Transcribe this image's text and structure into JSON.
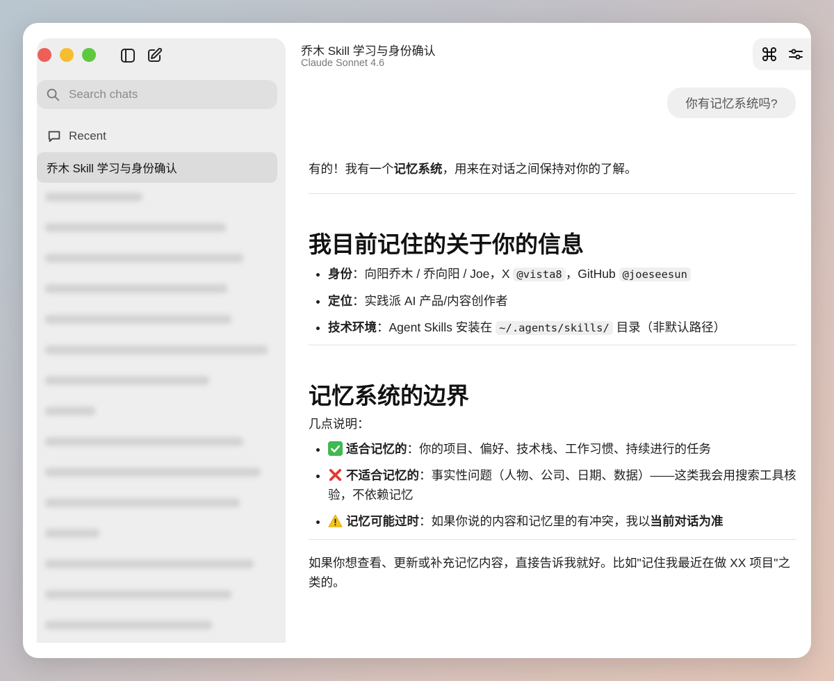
{
  "sidebar": {
    "search_placeholder": "Search chats",
    "recent_label": "Recent",
    "active_chat": "乔木 Skill 学习与身份确认"
  },
  "header": {
    "title": "乔木 Skill 学习与身份确认",
    "model": "Claude Sonnet 4.6"
  },
  "user_message": "你有记忆系统吗?",
  "assistant": {
    "intro_pre": "有的！我有一个",
    "intro_bold": "记忆系统",
    "intro_post": "，用来在对话之间保持对你的了解。",
    "section1_title": "我目前记住的关于你的信息",
    "s1_item1_label": "身份",
    "s1_item1_text1": "：向阳乔木 / 乔向阳 / Joe，X ",
    "s1_item1_code1": "@vista8",
    "s1_item1_text2": "，GitHub ",
    "s1_item1_code2": "@joeseesun",
    "s1_item2_label": "定位",
    "s1_item2_text": "：实践派 AI 产品/内容创作者",
    "s1_item3_label": "技术环境",
    "s1_item3_text1": "：Agent Skills 安装在 ",
    "s1_item3_code": "~/.agents/skills/",
    "s1_item3_text2": " 目录（非默认路径）",
    "section2_title": "记忆系统的边界",
    "section2_intro": "几点说明：",
    "s2_item1_label": "适合记忆的",
    "s2_item1_text": "：你的项目、偏好、技术栈、工作习惯、持续进行的任务",
    "s2_item2_label": "不适合记忆的",
    "s2_item2_text": "：事实性问题（人物、公司、日期、数据）——这类我会用搜索工具核验，不依赖记忆",
    "s2_item3_label": "记忆可能过时",
    "s2_item3_text1": "：如果你说的内容和记忆里的有冲突，我以",
    "s2_item3_bold": "当前对话为准",
    "closing": "如果你想查看、更新或补充记忆内容，直接告诉我就好。比如\"记住我最近在做 XX 项目\"之类的。"
  },
  "icons": [
    "sidebar-toggle-icon",
    "new-chat-icon",
    "search-icon",
    "chat-bubble-icon",
    "command-icon",
    "sliders-icon",
    "check-emoji-icon",
    "cross-emoji-icon",
    "warning-emoji-icon"
  ],
  "colors": {
    "close": "#ee5f57",
    "minimize": "#f6be2f",
    "zoom": "#5fc83f",
    "check": "#3fb950",
    "cross": "#e53935",
    "warning": "#f5c518"
  }
}
